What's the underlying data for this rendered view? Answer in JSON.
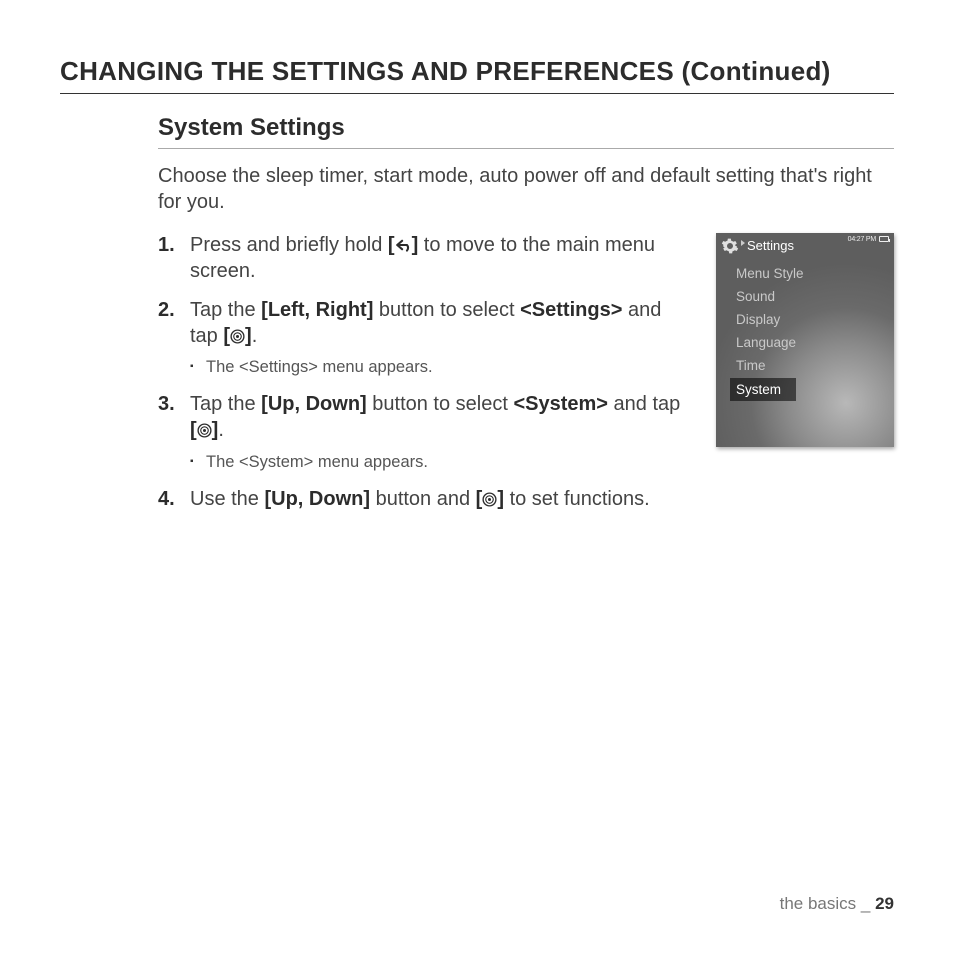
{
  "page_title": "CHANGING THE SETTINGS AND PREFERENCES (Continued)",
  "subheading": "System Settings",
  "intro": "Choose the sleep timer, start mode, auto power off and default setting that's right for you.",
  "steps": [
    {
      "num": "1.",
      "pre": "Press and briefly hold ",
      "bold_a": "[",
      "bold_b": "]",
      "post": " to move to the main menu screen.",
      "icon": "back"
    },
    {
      "num": "2.",
      "parts": {
        "a": "Tap the ",
        "b": "[Left, Right]",
        "c": " button to select ",
        "d": "<Settings>",
        "e": " and tap ",
        "f": "[",
        "g": "]",
        "h": "."
      },
      "sub": "The <Settings> menu appears."
    },
    {
      "num": "3.",
      "parts": {
        "a": "Tap the ",
        "b": "[Up, Down]",
        "c": " button to select ",
        "d": "<System>",
        "e": " and tap ",
        "f": "[",
        "g": "]",
        "h": "."
      },
      "sub": "The <System> menu appears."
    },
    {
      "num": "4.",
      "parts": {
        "a": "Use the ",
        "b": "[Up, Down]",
        "c": " button and ",
        "f": "[",
        "g": "]",
        "h": " to set functions."
      }
    }
  ],
  "device": {
    "title": "Settings",
    "time": "04:27 PM",
    "menu": [
      "Menu Style",
      "Sound",
      "Display",
      "Language",
      "Time",
      "System"
    ],
    "selected_index": 5
  },
  "footer": {
    "section": "the basics",
    "sep": " _ ",
    "page": "29"
  }
}
